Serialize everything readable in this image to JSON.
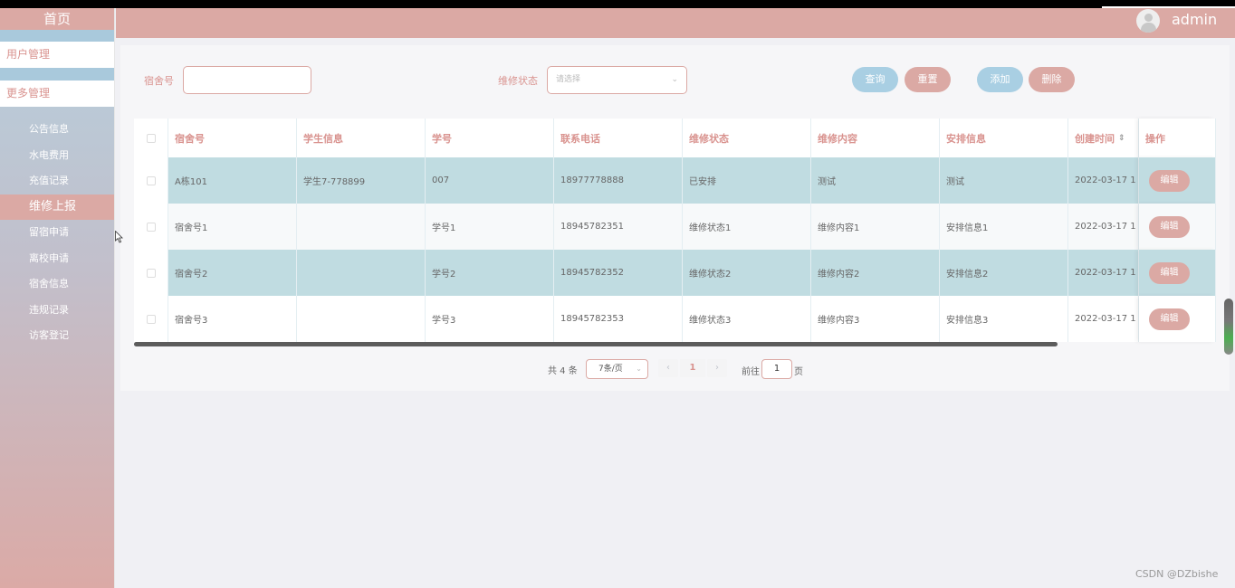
{
  "sidebar": {
    "home_label": "首页",
    "user_mgmt": "用户管理",
    "more_mgmt": "更多管理",
    "items": [
      {
        "label": "公告信息",
        "active": false
      },
      {
        "label": "水电费用",
        "active": false
      },
      {
        "label": "充值记录",
        "active": false
      },
      {
        "label": "维修上报",
        "active": true
      },
      {
        "label": "留宿申请",
        "active": false
      },
      {
        "label": "离校申请",
        "active": false
      },
      {
        "label": "宿舍信息",
        "active": false
      },
      {
        "label": "违规记录",
        "active": false
      },
      {
        "label": "访客登记",
        "active": false
      }
    ]
  },
  "header": {
    "username": "admin",
    "avatar_icon": "user-avatar-icon"
  },
  "filters": {
    "dorm_label": "宿舍号",
    "dorm_value": "",
    "status_label": "维修状态",
    "status_placeholder": "请选择"
  },
  "buttons": {
    "search": "查询",
    "reset": "重置",
    "add": "添加",
    "delete": "删除"
  },
  "table": {
    "columns": [
      "宿舍号",
      "学生信息",
      "学号",
      "联系电话",
      "维修状态",
      "维修内容",
      "安排信息",
      "创建时间",
      "操作"
    ],
    "sort_icon": "⇕",
    "edit_label": "编辑",
    "rows": [
      [
        "A栋101",
        "学生7-778899",
        "007",
        "18977778888",
        "已安排",
        "测试",
        "测试",
        "2022-03-17 1"
      ],
      [
        "宿舍号1",
        "",
        "学号1",
        "18945782351",
        "维修状态1",
        "维修内容1",
        "安排信息1",
        "2022-03-17 1"
      ],
      [
        "宿舍号2",
        "",
        "学号2",
        "18945782352",
        "维修状态2",
        "维修内容2",
        "安排信息2",
        "2022-03-17 1"
      ],
      [
        "宿舍号3",
        "",
        "学号3",
        "18945782353",
        "维修状态3",
        "维修内容3",
        "安排信息3",
        "2022-03-17 1"
      ]
    ]
  },
  "pagination": {
    "total": "共 4 条",
    "page_size": "7条/页",
    "prev": "‹",
    "next": "›",
    "current": "1",
    "goto_label": "前往",
    "goto_value": "1",
    "page_suffix": "页"
  },
  "colors": {
    "accent": "#dba9a4",
    "secondary": "#a9cfe3",
    "row_highlight": "#c0dce1"
  },
  "watermark": "CSDN @DZbishe"
}
